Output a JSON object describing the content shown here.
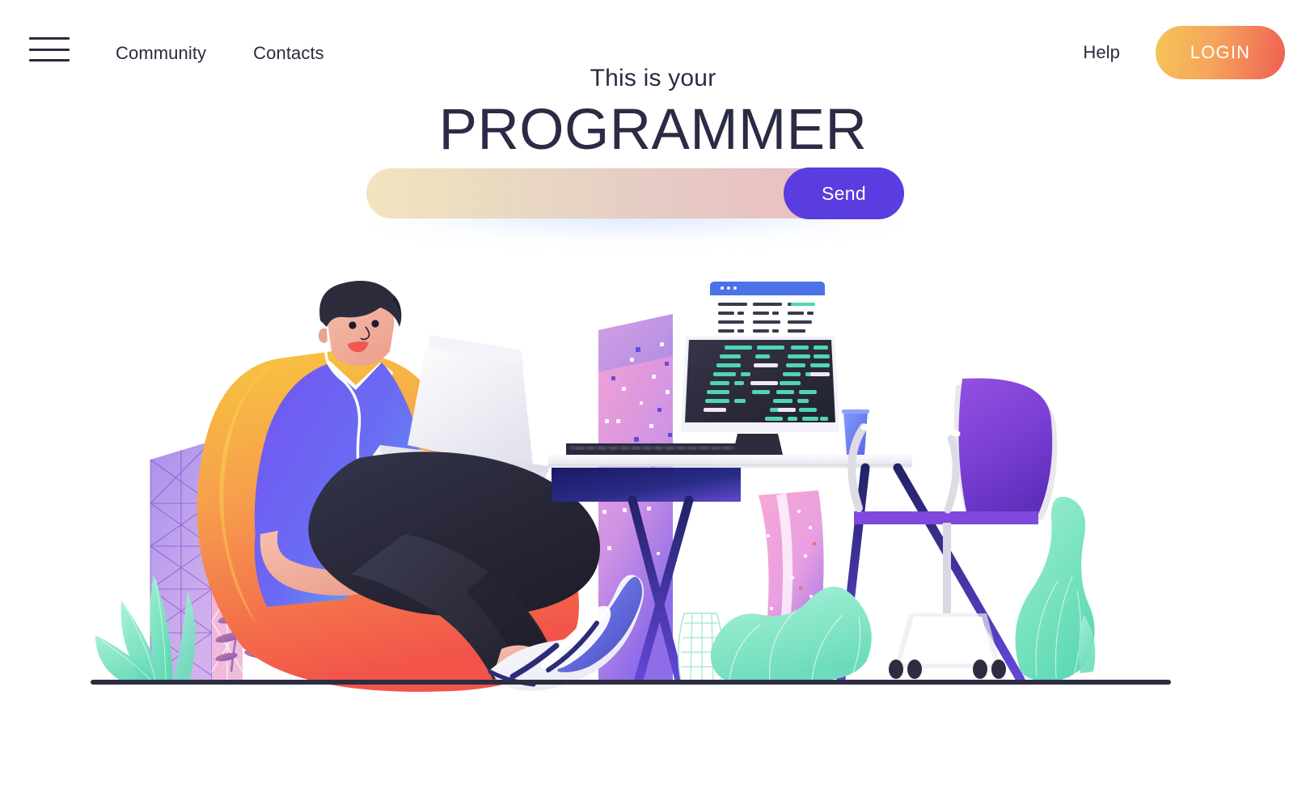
{
  "nav": {
    "menu_icon": "hamburger-menu-icon",
    "left_links": [
      {
        "label": "Community"
      },
      {
        "label": "Contacts"
      }
    ],
    "right_links": [
      {
        "label": "Help"
      }
    ],
    "login_label": "LOGIN",
    "login_gradient_from": "#f6c557",
    "login_gradient_to": "#ef5f53"
  },
  "hero": {
    "eyebrow": "This is your",
    "title": "PROGRAMMER",
    "title_color": "#2b2b45"
  },
  "search": {
    "value": "",
    "placeholder": "",
    "send_label": "Send",
    "send_color": "#5b3cde",
    "field_gradient_from": "#f2e4bd",
    "field_gradient_to": "#eab9bd"
  },
  "illustration": {
    "name": "programmer-working-illustration",
    "alt": "Man sitting in an orange bean bag chair with a laptop next to a desk with a monitor, keyboard, cup, office chair and plants",
    "colors": {
      "beanbag_top": "#f7c144",
      "beanbag_bottom": "#f2564c",
      "shirt_left": "#6f5bf0",
      "shirt_right": "#5f8df3",
      "pants": "#2b2b3c",
      "skin": "#f0ab9a",
      "hair": "#2b2b3c",
      "desk_top": "#f4f4f8",
      "desk_apron": "#1d1f6e",
      "desk_leg": "#2a2b7a",
      "monitor_screen": "#2d2c3e",
      "code_text": "#4fd6b0",
      "browser_bar": "#4b72e8",
      "chair": "#7b3fd4",
      "chair_base": "#dcdce4",
      "cup": "#6f8cf2",
      "plant_mint": "#7fe3c2",
      "panel_pink": "#f3a8d4",
      "panel_purple": "#9b7ae8",
      "ground_line": "#2d2d42",
      "shoe_blue": "#3a3fa8"
    }
  }
}
